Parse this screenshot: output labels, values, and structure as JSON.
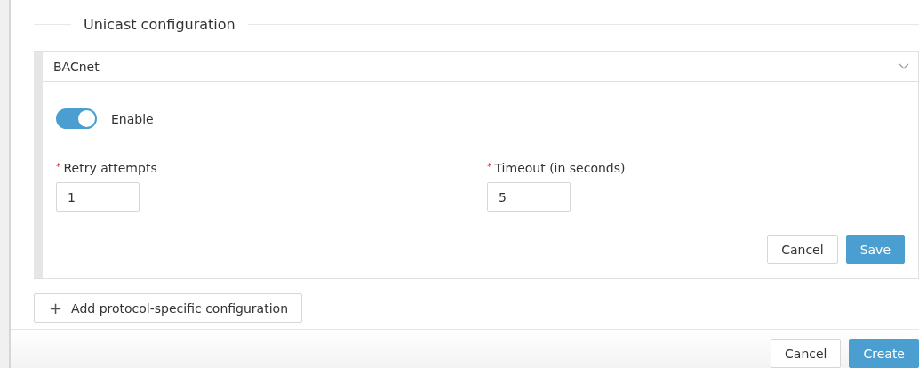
{
  "section": {
    "title": "Unicast configuration"
  },
  "protocol_panel": {
    "title": "BACnet",
    "expanded": true,
    "enable": {
      "label": "Enable",
      "on": true
    },
    "fields": [
      {
        "label": "Retry attempts",
        "required_mark": "*",
        "value": "1"
      },
      {
        "label": "Timeout (in seconds)",
        "required_mark": "*",
        "value": "5"
      }
    ],
    "buttons": [
      {
        "label": "Cancel",
        "kind": "secondary"
      },
      {
        "label": "Save",
        "kind": "primary"
      }
    ]
  },
  "add_button": {
    "label": "Add protocol-specific configuration",
    "icon": "+"
  },
  "footer": {
    "buttons": [
      {
        "label": "Cancel",
        "kind": "secondary"
      },
      {
        "label": "Create",
        "kind": "primary"
      }
    ]
  }
}
